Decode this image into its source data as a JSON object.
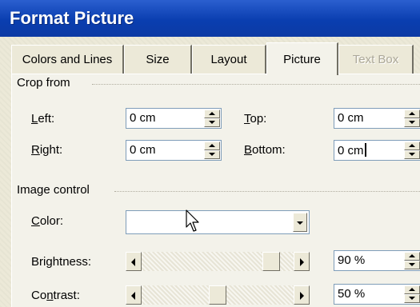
{
  "window": {
    "title": "Format Picture"
  },
  "tabs": [
    {
      "label": "Colors and Lines",
      "active": false,
      "disabled": false
    },
    {
      "label": "Size",
      "active": false,
      "disabled": false
    },
    {
      "label": "Layout",
      "active": false,
      "disabled": false
    },
    {
      "label": "Picture",
      "active": true,
      "disabled": false
    },
    {
      "label": "Text Box",
      "active": false,
      "disabled": true
    }
  ],
  "crop": {
    "section_title": "Crop from",
    "left": {
      "label_accel": "L",
      "label_rest": "eft:",
      "value": "0 cm"
    },
    "right": {
      "label_accel": "R",
      "label_rest": "ight:",
      "value": "0 cm"
    },
    "top": {
      "label_accel": "T",
      "label_rest": "op:",
      "value": "0 cm"
    },
    "bottom": {
      "label_accel": "B",
      "label_rest": "ottom:",
      "value": "0 cm"
    }
  },
  "image_control": {
    "section_title": "Image control",
    "color": {
      "label_accel": "C",
      "label_rest": "olor:",
      "value": ""
    },
    "brightness": {
      "label_pre": "Bri",
      "label_accel": "g",
      "label_rest": "htness:",
      "value": "90 %",
      "level": 0.9
    },
    "contrast": {
      "label_pre": "Co",
      "label_accel": "n",
      "label_rest": "trast:",
      "value": "50 %",
      "level": 0.5
    }
  },
  "colors": {
    "titlebar": "#0a3eb0",
    "dialog_face": "#ece9d8",
    "field_border": "#7f9db9"
  },
  "icons": {
    "spin_up": "triangle-up-icon",
    "spin_down": "triangle-down-icon",
    "dropdown": "chevron-down-icon",
    "scroll_left": "arrow-left-icon",
    "scroll_right": "arrow-right-icon",
    "pointer": "mouse-pointer-icon"
  }
}
